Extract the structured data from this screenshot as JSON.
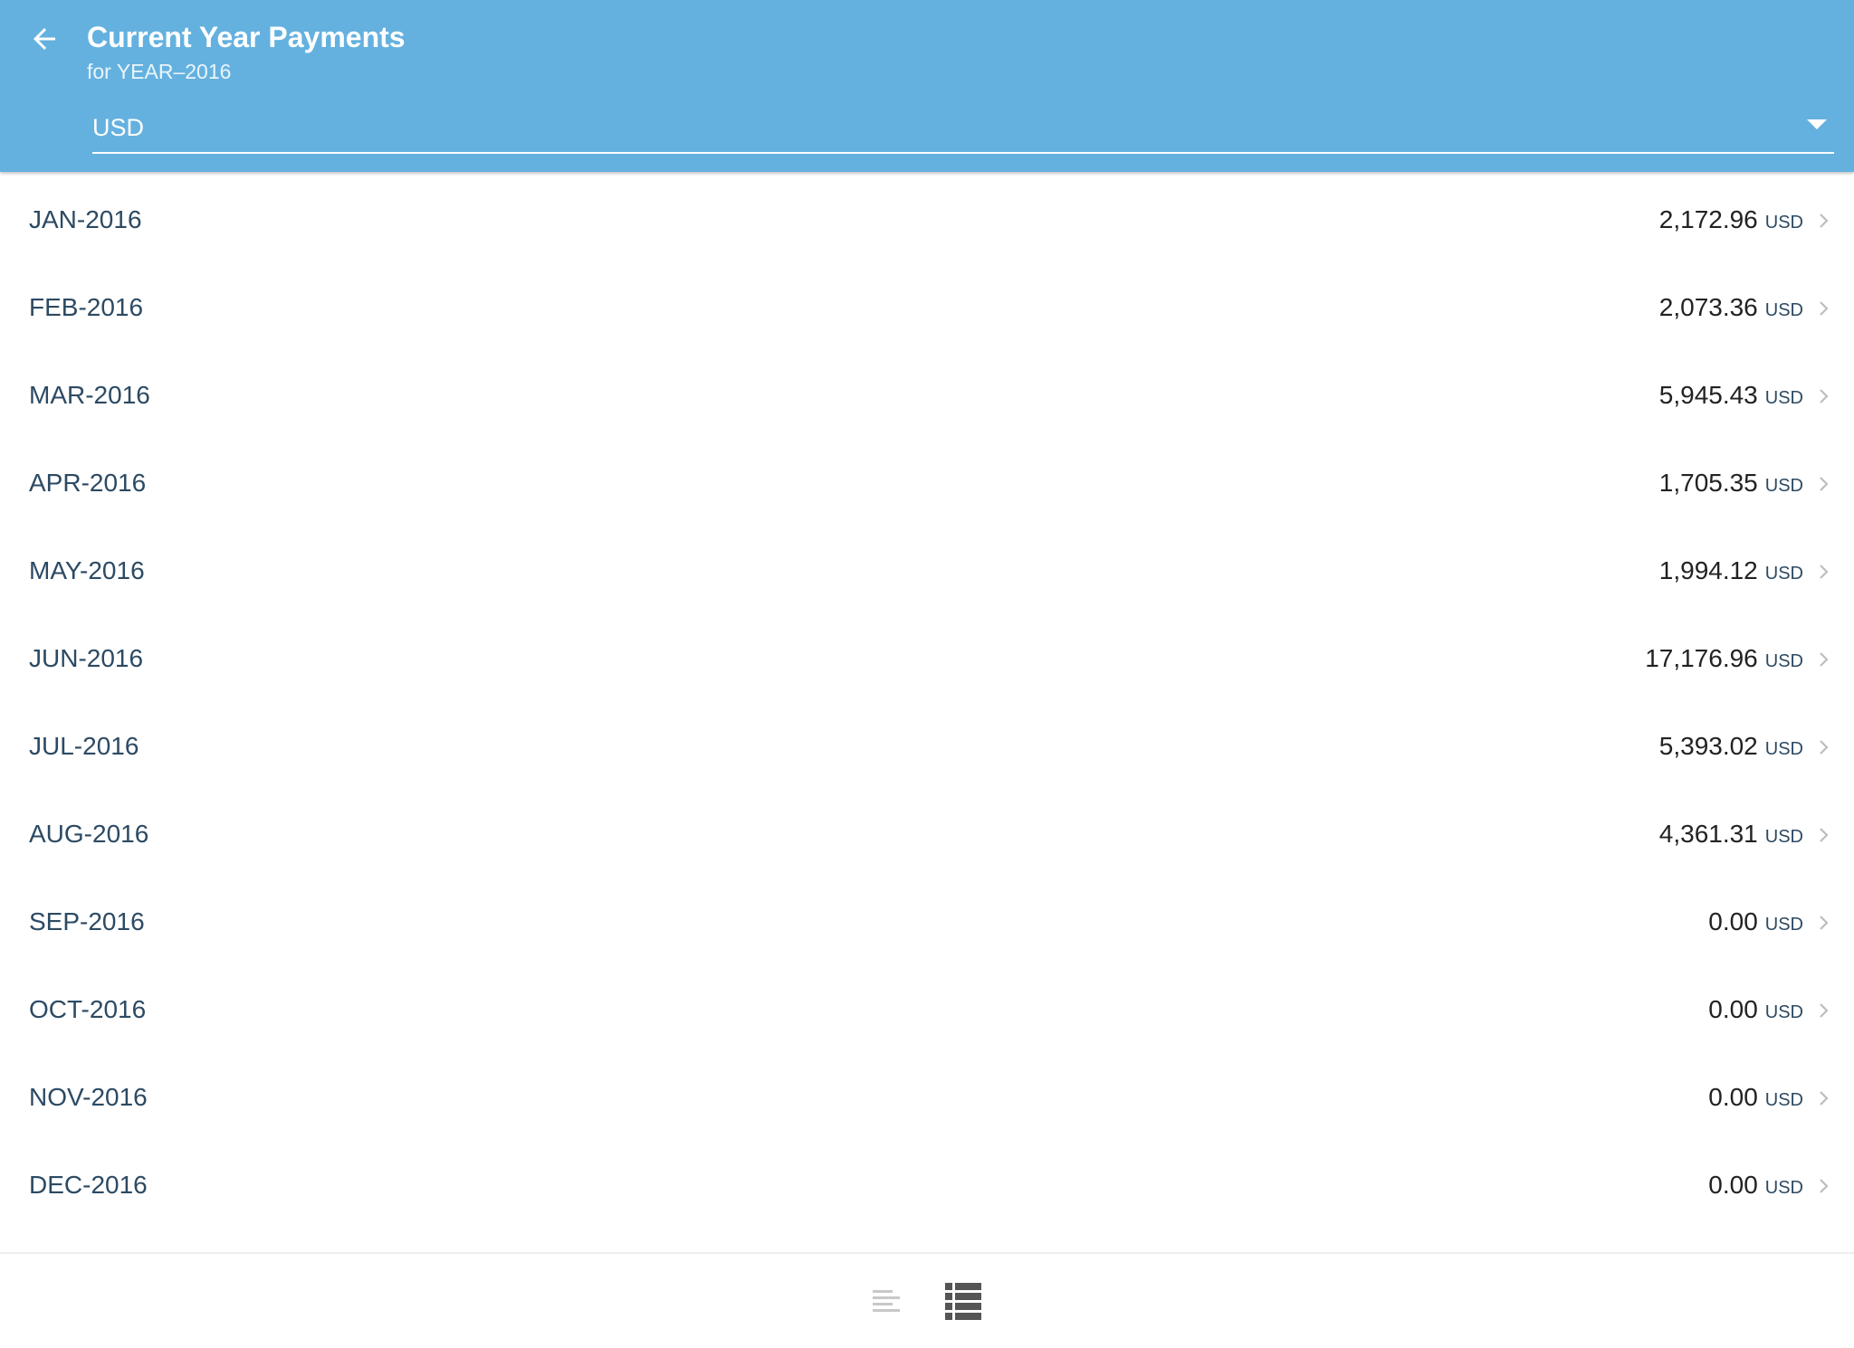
{
  "header": {
    "title": "Current Year Payments",
    "subtitle": "for YEAR–2016",
    "back_icon": "arrow-left-icon",
    "background_color": "#64b1df"
  },
  "currency_select": {
    "selected": "USD",
    "arrow_icon": "dropdown-arrow-icon"
  },
  "payments": [
    {
      "month": "JAN-2016",
      "amount": "2,172.96",
      "currency": "USD"
    },
    {
      "month": "FEB-2016",
      "amount": "2,073.36",
      "currency": "USD"
    },
    {
      "month": "MAR-2016",
      "amount": "5,945.43",
      "currency": "USD"
    },
    {
      "month": "APR-2016",
      "amount": "1,705.35",
      "currency": "USD"
    },
    {
      "month": "MAY-2016",
      "amount": "1,994.12",
      "currency": "USD"
    },
    {
      "month": "JUN-2016",
      "amount": "17,176.96",
      "currency": "USD"
    },
    {
      "month": "JUL-2016",
      "amount": "5,393.02",
      "currency": "USD"
    },
    {
      "month": "AUG-2016",
      "amount": "4,361.31",
      "currency": "USD"
    },
    {
      "month": "SEP-2016",
      "amount": "0.00",
      "currency": "USD"
    },
    {
      "month": "OCT-2016",
      "amount": "0.00",
      "currency": "USD"
    },
    {
      "month": "NOV-2016",
      "amount": "0.00",
      "currency": "USD"
    },
    {
      "month": "DEC-2016",
      "amount": "0.00",
      "currency": "USD"
    }
  ],
  "bottom_bar": {
    "views": [
      {
        "icon": "summary-view-icon",
        "active": false
      },
      {
        "icon": "detail-list-view-icon",
        "active": true
      }
    ],
    "active_color": "#555555",
    "inactive_color": "#c8c8c8"
  }
}
